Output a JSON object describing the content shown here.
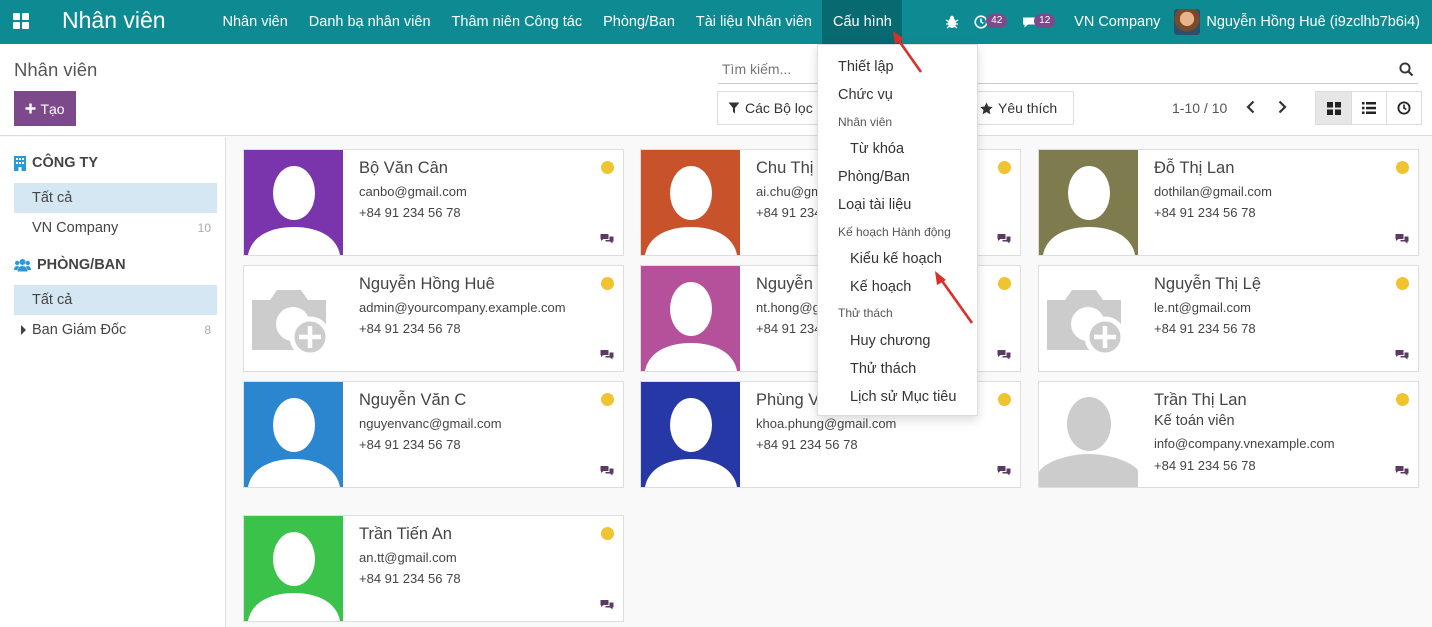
{
  "navbar": {
    "brand": "Nhân viên",
    "menu": [
      "Nhân viên",
      "Danh bạ nhân viên",
      "Thâm niên Công tác",
      "Phòng/Ban",
      "Tài liệu Nhân viên",
      "Cấu hình"
    ],
    "activities_count": "42",
    "messages_count": "12",
    "company": "VN Company",
    "user": "Nguyễn Hồng Huê (i9zclhb7b6i4)"
  },
  "control": {
    "breadcrumb": "Nhân viên",
    "create_label": "Tạo",
    "search_placeholder": "Tìm kiếm...",
    "filters_label": "Các Bộ lọc",
    "favorites_label": "Yêu thích",
    "pager": "1-10 / 10"
  },
  "sidebar": {
    "company_header": "CÔNG TY",
    "company_items": [
      {
        "label": "Tất cả",
        "count": ""
      },
      {
        "label": "VN Company",
        "count": "10"
      }
    ],
    "department_header": "PHÒNG/BAN",
    "department_items": [
      {
        "label": "Tất cả",
        "count": ""
      },
      {
        "label": "Ban Giám Đốc",
        "count": "8"
      }
    ]
  },
  "cards": [
    {
      "name": "Bộ Văn Cân",
      "job": "",
      "email": "canbo@gmail.com",
      "phone": "+84 91 234 56 78",
      "photo": "silhouette",
      "bg": "#7a35ad"
    },
    {
      "name": "Chu Thị A",
      "job": "",
      "email": "ai.chu@gm",
      "phone": "+84 91 234",
      "photo": "silhouette",
      "bg": "#c8522a"
    },
    {
      "name": "Đỗ Thị Lan",
      "job": "",
      "email": "dothilan@gmail.com",
      "phone": "+84 91 234 56 78",
      "photo": "silhouette",
      "bg": "#7e7c4f"
    },
    {
      "name": "Nguyễn Hồng Huê",
      "job": "",
      "email": "admin@yourcompany.example.com",
      "phone": "+84 91 234 56 78",
      "photo": "camera",
      "bg": "#ffffff"
    },
    {
      "name": "Nguyễn T",
      "job": "",
      "email": "nt.hong@g",
      "phone": "+84 91 234",
      "photo": "silhouette",
      "bg": "#b4519a"
    },
    {
      "name": "Nguyễn Thị Lệ",
      "job": "",
      "email": "le.nt@gmail.com",
      "phone": "+84 91 234 56 78",
      "photo": "camera",
      "bg": "#ffffff"
    },
    {
      "name": "Nguyễn Văn C",
      "job": "",
      "email": "nguyenvanc@gmail.com",
      "phone": "+84 91 234 56 78",
      "photo": "silhouette",
      "bg": "#2c86cf"
    },
    {
      "name": "Phùng V",
      "job": "",
      "email": "khoa.phung@gmail.com",
      "phone": "+84 91 234 56 78",
      "photo": "silhouette",
      "bg": "#2638a6"
    },
    {
      "name": "Trần Thị Lan",
      "job": "Kế toán viên",
      "email": "info@company.vnexample.com",
      "phone": "+84 91 234 56 78",
      "photo": "grey",
      "bg": "#ffffff"
    },
    {
      "name": "Trần Tiến An",
      "job": "",
      "email": "an.tt@gmail.com",
      "phone": "+84 91 234 56 78",
      "photo": "silhouette",
      "bg": "#3bc24a"
    }
  ],
  "dropdown": {
    "items": [
      {
        "label": "Thiết lập",
        "kind": "item"
      },
      {
        "label": "Chức vụ",
        "kind": "item"
      },
      {
        "label": "Nhân viên",
        "kind": "header"
      },
      {
        "label": "Từ khóa",
        "kind": "sub"
      },
      {
        "label": "Phòng/Ban",
        "kind": "item"
      },
      {
        "label": "Loại tài liệu",
        "kind": "item"
      },
      {
        "label": "Kế hoạch Hành động",
        "kind": "header"
      },
      {
        "label": "Kiểu kế hoạch",
        "kind": "sub"
      },
      {
        "label": "Kế hoạch",
        "kind": "sub"
      },
      {
        "label": "Thử thách",
        "kind": "header"
      },
      {
        "label": "Huy chương",
        "kind": "sub"
      },
      {
        "label": "Thử thách",
        "kind": "sub"
      },
      {
        "label": "Lịch sử Mục tiêu",
        "kind": "sub"
      }
    ]
  },
  "colors": {
    "navbar": "#0e8b92",
    "navbar_active": "#076a70",
    "primary_button": "#7c4a8a",
    "selected_filter": "#d5e7f2",
    "status_dot": "#f0c330",
    "annotation_arrow": "#d9302a"
  }
}
